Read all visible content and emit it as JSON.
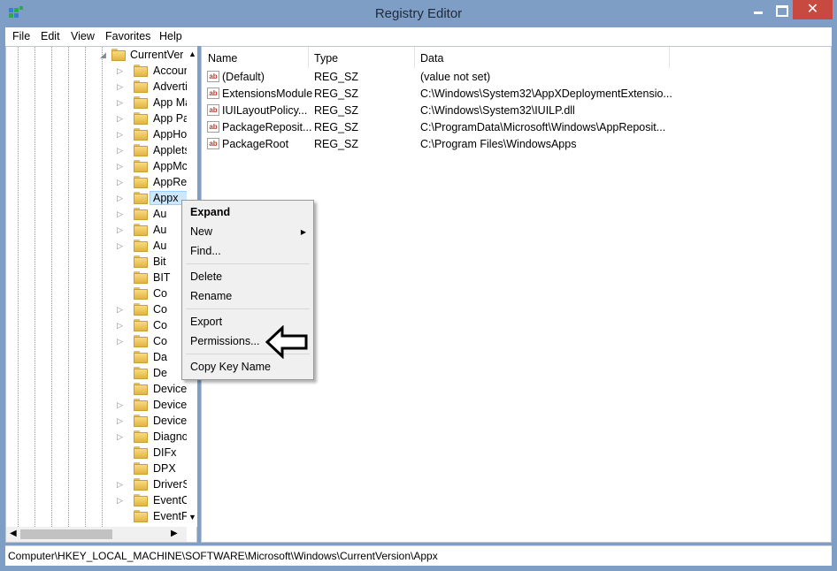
{
  "window": {
    "title": "Registry Editor",
    "close_glyph": "✕"
  },
  "menu": [
    "File",
    "Edit",
    "View",
    "Favorites",
    "Help"
  ],
  "tree": {
    "parent": "CurrentVer",
    "items": [
      "Accoun",
      "Adverti",
      "App Ma",
      "App Pa",
      "AppHo",
      "Applets",
      "AppMc",
      "AppRe",
      "Appx",
      "Au",
      "Au",
      "Au",
      "Bit",
      "BIT",
      "Co",
      "Co",
      "Co",
      "Co",
      "Da",
      "De",
      "Device",
      "DeviceA",
      "DeviceS",
      "Diagno",
      "DIFx",
      "DPX",
      "DriverS",
      "EventC",
      "EventFo"
    ],
    "selected_index": 8
  },
  "list": {
    "headers": [
      "Name",
      "Type",
      "Data"
    ],
    "rows": [
      {
        "name": "(Default)",
        "type": "REG_SZ",
        "data": "(value not set)"
      },
      {
        "name": "ExtensionsModule",
        "type": "REG_SZ",
        "data": "C:\\Windows\\System32\\AppXDeploymentExtensio..."
      },
      {
        "name": "IUILayoutPolicy...",
        "type": "REG_SZ",
        "data": "C:\\Windows\\System32\\IUILP.dll"
      },
      {
        "name": "PackageReposit...",
        "type": "REG_SZ",
        "data": "C:\\ProgramData\\Microsoft\\Windows\\AppReposit..."
      },
      {
        "name": "PackageRoot",
        "type": "REG_SZ",
        "data": "C:\\Program Files\\WindowsApps"
      }
    ]
  },
  "context_menu": {
    "expand": "Expand",
    "new": "New",
    "find": "Find...",
    "delete": "Delete",
    "rename": "Rename",
    "export": "Export",
    "permissions": "Permissions...",
    "copy_key_name": "Copy Key Name",
    "submenu_glyph": "▶"
  },
  "status": "Computer\\HKEY_LOCAL_MACHINE\\SOFTWARE\\Microsoft\\Windows\\CurrentVersion\\Appx",
  "icons": {
    "value_icon": "ab",
    "expander_closed": "▷",
    "expander_open": "◢"
  },
  "colors": {
    "titlebar": "#7f9ec6",
    "close_button": "#c7493f",
    "selection": "#cce8ff"
  }
}
